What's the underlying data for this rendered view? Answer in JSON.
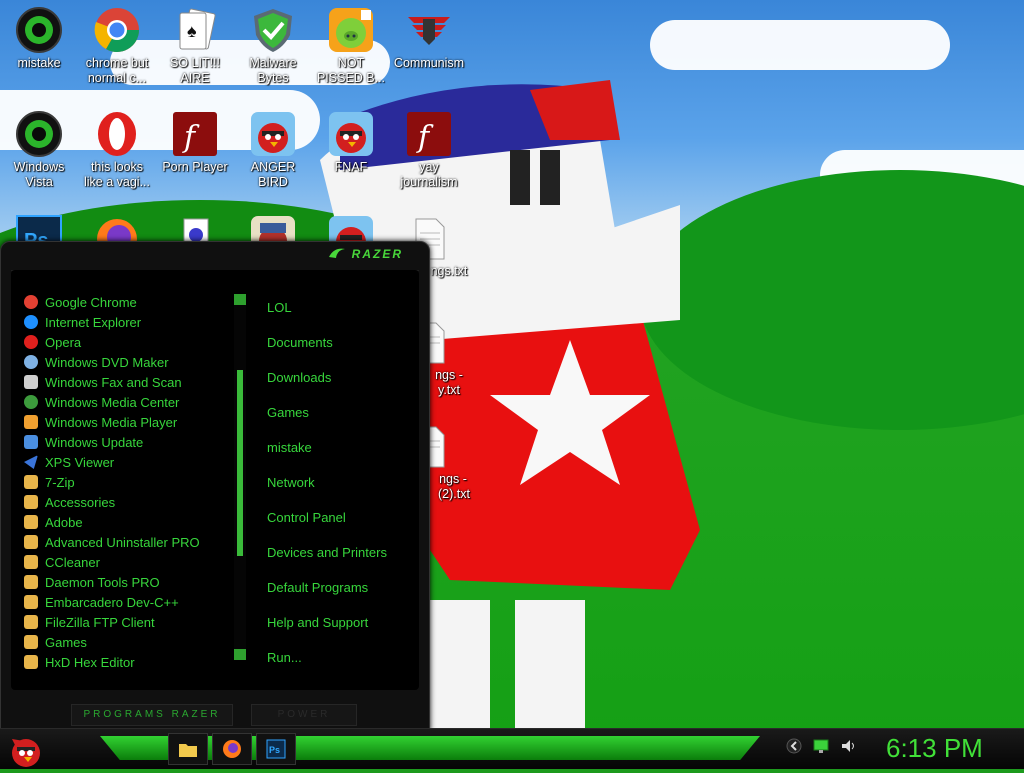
{
  "desktop_icons": [
    {
      "label": "mistake",
      "icon": "razer-orb-icon"
    },
    {
      "label": "chrome but\nnormal c...",
      "icon": "chrome-icon"
    },
    {
      "label": "SO LIT!!!\nAIRE",
      "icon": "solitaire-icon"
    },
    {
      "label": "Malware\nBytes",
      "icon": "malwarebytes-icon"
    },
    {
      "label": "NOT\nPISSED B...",
      "icon": "bad-piggies-icon"
    },
    {
      "label": "Communism",
      "icon": "communism-icon"
    },
    {
      "label": "Windows\nVista",
      "icon": "razer-orb-icon"
    },
    {
      "label": "this looks\nlike a vagi...",
      "icon": "opera-icon"
    },
    {
      "label": "Porn Player",
      "icon": "flash-icon"
    },
    {
      "label": "ANGER\nBIRD",
      "icon": "angry-birds-icon"
    },
    {
      "label": "FNAF",
      "icon": "angry-birds-icon"
    },
    {
      "label": "yay\njournalism",
      "icon": "flash-icon"
    },
    {
      "label": "Ps",
      "icon": "photoshop-icon"
    },
    {
      "label": "",
      "icon": "firefox-icon"
    },
    {
      "label": "",
      "icon": "spider-solitaire-icon"
    },
    {
      "label": "",
      "icon": "angry-birds-seasons-icon"
    },
    {
      "label": "",
      "icon": "angry-birds-icon"
    },
    {
      "label": "ngs.txt",
      "icon": "text-file-icon"
    },
    {
      "label": "ngs -\ny.txt",
      "icon": "text-file-icon"
    },
    {
      "label": "ngs -\n(2).txt",
      "icon": "text-file-icon"
    }
  ],
  "start_menu": {
    "logo": "RAZER",
    "programs": [
      {
        "label": "Google Chrome",
        "color": "#e34133"
      },
      {
        "label": "Internet Explorer",
        "color": "#1e90ff"
      },
      {
        "label": "Opera",
        "color": "#e0201d"
      },
      {
        "label": "Windows DVD Maker",
        "color": "#7fb2e5"
      },
      {
        "label": "Windows Fax and Scan",
        "color": "#cfcfcf"
      },
      {
        "label": "Windows Media Center",
        "color": "#3c9b3c"
      },
      {
        "label": "Windows Media Player",
        "color": "#f0a030"
      },
      {
        "label": "Windows Update",
        "color": "#4b8fe0"
      },
      {
        "label": "XPS Viewer",
        "color": "#3a74d9"
      },
      {
        "label": "7-Zip",
        "color": "#e8b54a"
      },
      {
        "label": "Accessories",
        "color": "#e8b54a"
      },
      {
        "label": "Adobe",
        "color": "#e8b54a"
      },
      {
        "label": "Advanced Uninstaller PRO",
        "color": "#e8b54a"
      },
      {
        "label": "CCleaner",
        "color": "#e8b54a"
      },
      {
        "label": "Daemon Tools PRO",
        "color": "#e8b54a"
      },
      {
        "label": "Embarcadero Dev-C++",
        "color": "#e8b54a"
      },
      {
        "label": "FileZilla FTP Client",
        "color": "#e8b54a"
      },
      {
        "label": "Games",
        "color": "#e8b54a"
      },
      {
        "label": "HxD Hex Editor",
        "color": "#e8b54a"
      }
    ],
    "places": [
      "LOL",
      "Documents",
      "Downloads",
      "Games",
      "mistake",
      "Network",
      "Control Panel",
      "Devices and Printers",
      "Default Programs",
      "Help and Support",
      "Run..."
    ],
    "programs_button": "PROGRAMS RAZER",
    "power_button": "POWER"
  },
  "taskbar": {
    "items": [
      "folder-icon",
      "firefox-icon",
      "photoshop-icon"
    ],
    "photoshop_label": "Ps",
    "tray": [
      "chevron-left-icon",
      "network-icon",
      "volume-icon"
    ],
    "clock": "6:13 PM"
  },
  "colors": {
    "accent": "#37d63c",
    "menu_bg": "#000000"
  }
}
